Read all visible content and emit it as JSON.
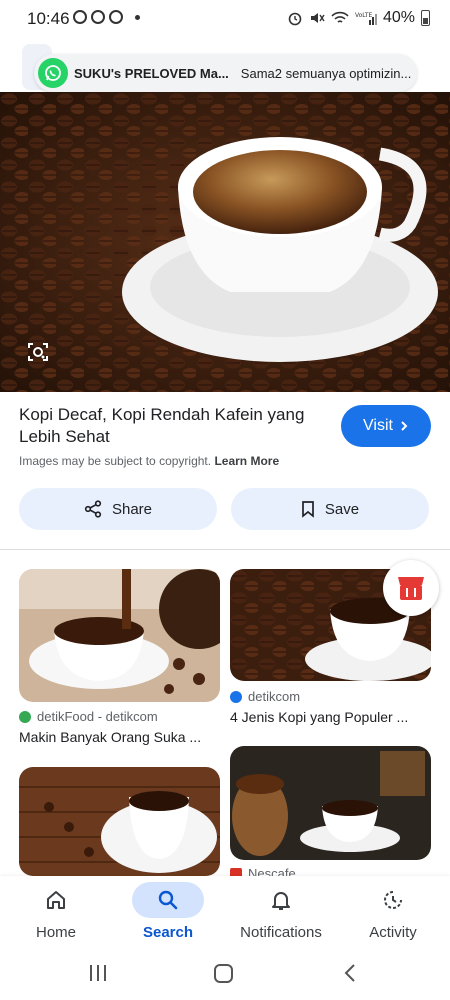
{
  "status_bar": {
    "time": "10:46",
    "battery_percent": "40%"
  },
  "notification": {
    "app": "WhatsApp",
    "title": "SUKU's PRELOVED Ma...",
    "message": "Sama2 semuanya optimizin..."
  },
  "result": {
    "title": "Kopi Decaf, Kopi Rendah Kafein yang Lebih Sehat",
    "visit_label": "Visit",
    "copyright_text": "Images may be subject to copyright.",
    "learn_more_label": "Learn More",
    "share_label": "Share",
    "save_label": "Save"
  },
  "related": [
    {
      "source": "detikFood - detikcom",
      "title": "Makin Banyak Orang Suka ...",
      "source_color": "#34a853"
    },
    {
      "source": "detikcom",
      "title": "4 Jenis Kopi yang Populer ...",
      "source_color": "#1a73e8"
    },
    {
      "source": "",
      "title": ""
    },
    {
      "source": "Nescafe",
      "title": "",
      "source_color": "#d93025"
    }
  ],
  "bottom_nav": {
    "items": [
      {
        "label": "Home",
        "icon": "home-icon"
      },
      {
        "label": "Search",
        "icon": "search-icon",
        "active": true
      },
      {
        "label": "Notifications",
        "icon": "bell-icon"
      },
      {
        "label": "Activity",
        "icon": "activity-icon"
      }
    ]
  },
  "colors": {
    "accent": "#1a73e8",
    "action_button_bg": "#e8f0fe",
    "active_nav_pill": "#d3e3fd",
    "whatsapp_green": "#25d366"
  }
}
